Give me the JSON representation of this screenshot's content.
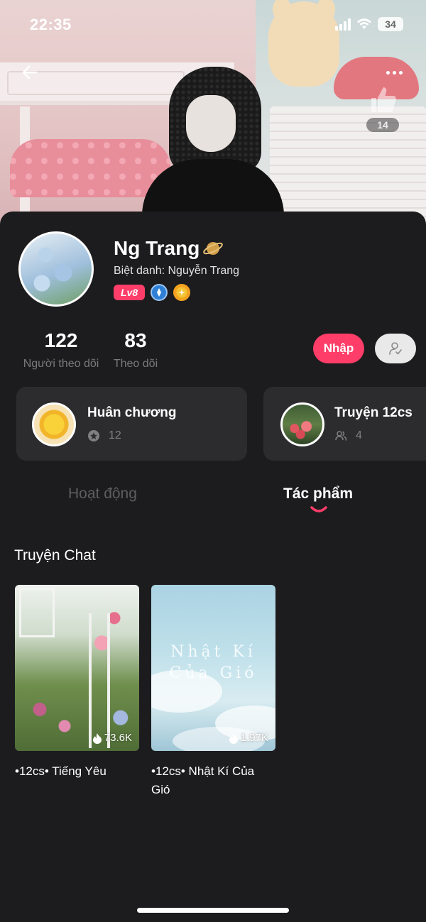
{
  "status_bar": {
    "time": "22:35",
    "battery": "34"
  },
  "header": {
    "like_count": "14"
  },
  "profile": {
    "name": "Ng Trang",
    "nickname": "Biệt danh: Nguyễn Trang",
    "level_badge": "Lv8",
    "followers": {
      "count": "122",
      "label": "Người theo dõi"
    },
    "following": {
      "count": "83",
      "label": "Theo dõi"
    },
    "enter_button": "Nhập"
  },
  "cards": [
    {
      "title": "Huân chương",
      "count": "12",
      "icon": "medal-icon"
    },
    {
      "title": "Truyện 12cs",
      "count": "4",
      "icon": "group-icon"
    }
  ],
  "tabs": [
    {
      "label": "Hoạt động",
      "active": false
    },
    {
      "label": "Tác phẩm",
      "active": true
    }
  ],
  "section": {
    "title": "Truyện Chat"
  },
  "stories": [
    {
      "title": "•12cs• Tiếng Yêu",
      "views": "73.6K"
    },
    {
      "title": "•12cs• Nhật Kí Của Gió",
      "views": "1.97K",
      "cover_text": [
        "Nhật Kí",
        "Của Gió"
      ]
    }
  ],
  "colors": {
    "accent": "#ff3d69",
    "background": "#1c1c1e",
    "card": "#2c2c2e",
    "muted": "#7a7a7c"
  }
}
